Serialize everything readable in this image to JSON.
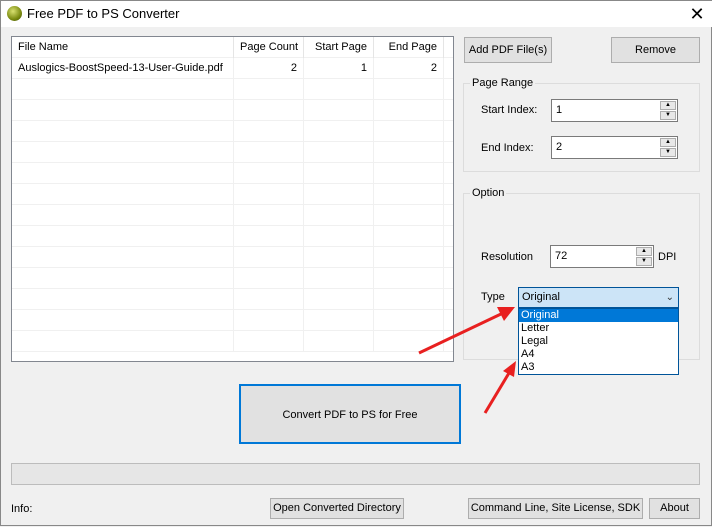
{
  "window": {
    "title": "Free PDF to PS Converter",
    "close": "✕"
  },
  "table": {
    "columns": [
      "File Name",
      "Page Count",
      "Start Page",
      "End Page"
    ],
    "rows": [
      {
        "file": "Auslogics-BoostSpeed-13-User-Guide.pdf",
        "page_count": "2",
        "start": "1",
        "end": "2"
      }
    ]
  },
  "buttons": {
    "add": "Add PDF File(s)",
    "remove": "Remove",
    "convert": "Convert PDF to PS for Free",
    "open_dir": "Open Converted Directory",
    "cmd": "Command Line, Site License, SDK",
    "about": "About"
  },
  "page_range": {
    "label": "Page Range",
    "start_label": "Start Index:",
    "start_value": "1",
    "end_label": "End Index:",
    "end_value": "2"
  },
  "option": {
    "label": "Option",
    "resolution_label": "Resolution",
    "resolution_value": "72",
    "dpi": "DPI",
    "type_label": "Type",
    "type_value": "Original",
    "type_options": [
      "Original",
      "Letter",
      "Legal",
      "A4",
      "A3"
    ]
  },
  "info": {
    "label": "Info:"
  },
  "progress": 0,
  "colors": {
    "accent": "#0078d7",
    "annotation_arrow": "#e82020"
  }
}
